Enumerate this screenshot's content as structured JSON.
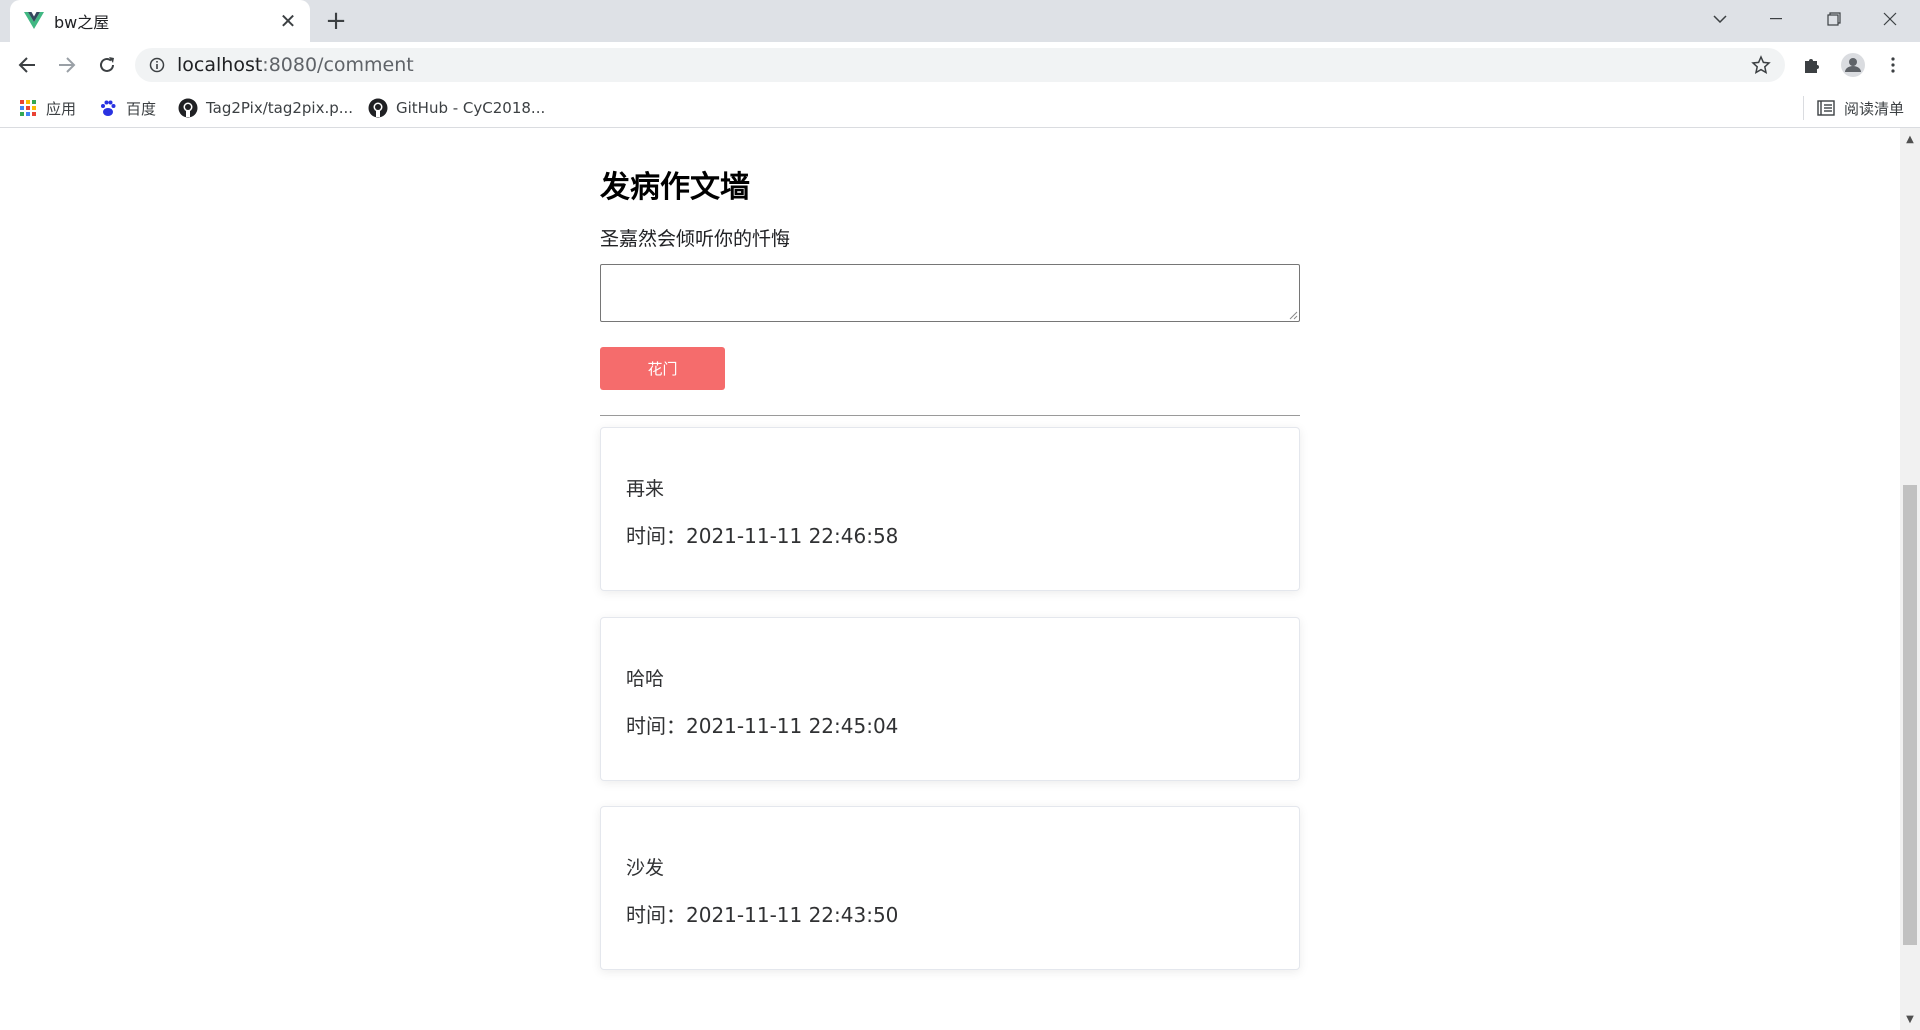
{
  "browser": {
    "tab_title": "bw之屋",
    "url_host": "localhost",
    "url_rest": ":8080/comment",
    "bookmarks": [
      {
        "label": "应用"
      },
      {
        "label": "百度"
      },
      {
        "label": "Tag2Pix/tag2pix.p..."
      },
      {
        "label": "GitHub - CyC2018..."
      }
    ],
    "reading_list": "阅读清单"
  },
  "page": {
    "title": "发病作文墙",
    "prompt": "圣嘉然会倾听你的忏悔",
    "textarea_value": "",
    "submit_label": "花门"
  },
  "comments": [
    {
      "text": "再来",
      "time": "时间：2021-11-11 22:46:58"
    },
    {
      "text": "哈哈",
      "time": "时间：2021-11-11 22:45:04"
    },
    {
      "text": "沙发",
      "time": "时间：2021-11-11 22:43:50"
    }
  ],
  "colors": {
    "accent": "#f56c6c",
    "vue_green": "#41b883",
    "vue_dark": "#34495e"
  }
}
